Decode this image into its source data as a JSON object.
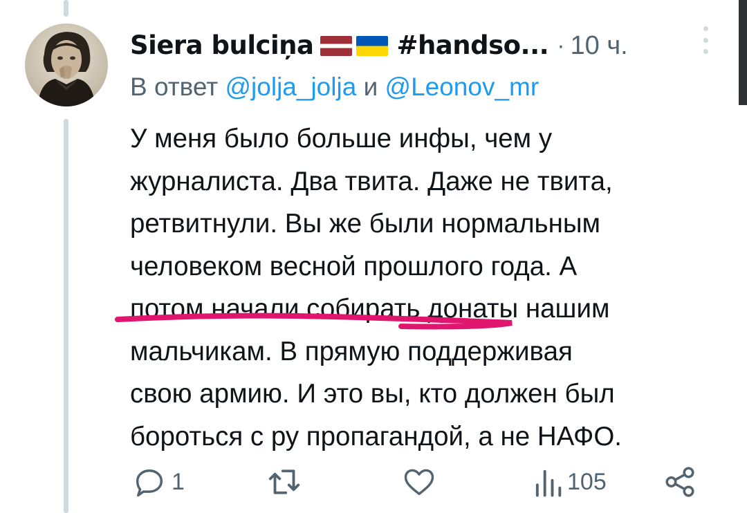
{
  "tweet": {
    "author": {
      "display_name": "Siera bulciņa",
      "hashtag": "#handso...",
      "flags": [
        "latvia-flag",
        "ukraine-flag"
      ],
      "avatar": "vintage-portrait-avatar"
    },
    "separator": "·",
    "time": "10 ч.",
    "reply_to": {
      "prefix": "В ответ",
      "mention1": "@jolja_jolja",
      "conjunction": "и",
      "mention2": "@Leonov_mr"
    },
    "text_lines": [
      "У меня было больше инфы, чем у",
      "журналиста. Два твита. Даже не твита,",
      "ретвитнули. Вы же были нормальным",
      "человеком весной прошлого года. А",
      "потом начали собирать донаты нашим",
      "мальчикам. В прямую поддерживая",
      "свою армию. И это вы, кто должен был",
      "бороться с ру пропагандой, а не НАФО."
    ],
    "stats": {
      "replies": "1",
      "retweets": "",
      "likes": "",
      "views": "105"
    }
  },
  "icons": {
    "reply": "reply-icon",
    "retweet": "retweet-icon",
    "like": "heart-icon",
    "views": "views-icon",
    "share": "share-icon",
    "more": "more-vertical-icon"
  },
  "colors": {
    "text": "#0f1419",
    "secondary": "#536471",
    "link": "#1d9bf0",
    "underline_marker": "#e0156e",
    "thread_line": "#cfd9de"
  }
}
